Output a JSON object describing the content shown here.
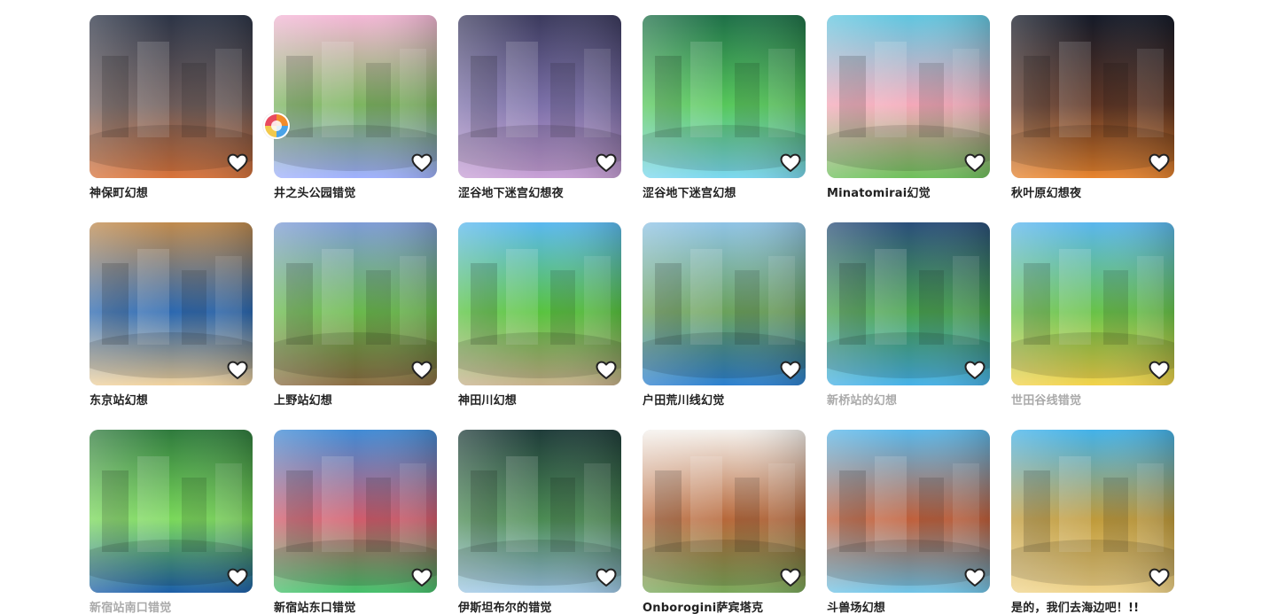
{
  "items": [
    {
      "title": "神保町幻想",
      "muted": false,
      "colors": [
        "#2c3446",
        "#6b5a58",
        "#d9733a"
      ],
      "icon": "heart-outline-icon"
    },
    {
      "title": "井之头公园错觉",
      "muted": false,
      "colors": [
        "#f4b6d6",
        "#7bb45e",
        "#9fb0ff"
      ],
      "icon": "heart-outline-icon"
    },
    {
      "title": "涩谷地下迷宫幻想夜",
      "muted": false,
      "colors": [
        "#3b3a5d",
        "#7b6fa8",
        "#c8a0d6"
      ],
      "icon": "heart-outline-icon"
    },
    {
      "title": "涩谷地下迷宫幻想",
      "muted": false,
      "colors": [
        "#1e6f48",
        "#56c75a",
        "#7ad7f0"
      ],
      "icon": "heart-outline-icon"
    },
    {
      "title": "Minatomirai幻觉",
      "muted": false,
      "colors": [
        "#5fc6e0",
        "#f4a7b8",
        "#6dc05a"
      ],
      "icon": "heart-outline-icon"
    },
    {
      "title": "秋叶原幻想夜",
      "muted": false,
      "colors": [
        "#141a28",
        "#5b3221",
        "#e8842e"
      ],
      "icon": "heart-outline-icon"
    },
    {
      "title": "东京站幻想",
      "muted": false,
      "colors": [
        "#c08a4c",
        "#2b68b0",
        "#f0d19c"
      ],
      "icon": "heart-outline-icon"
    },
    {
      "title": "上野站幻想",
      "muted": false,
      "colors": [
        "#7d9bd6",
        "#68b84a",
        "#8a6b42"
      ],
      "icon": "heart-outline-icon"
    },
    {
      "title": "神田川幻想",
      "muted": false,
      "colors": [
        "#5ab8f0",
        "#58c33e",
        "#c7b08a"
      ],
      "icon": "heart-outline-icon"
    },
    {
      "title": "户田荒川线幻觉",
      "muted": false,
      "colors": [
        "#8fc3e6",
        "#6aa15a",
        "#2b7fd0"
      ],
      "icon": "heart-outline-icon"
    },
    {
      "title": "新桥站的幻想",
      "muted": true,
      "colors": [
        "#2a4e7a",
        "#46a14d",
        "#46b1e8"
      ],
      "icon": "heart-outline-icon"
    },
    {
      "title": "世田谷线错觉",
      "muted": true,
      "colors": [
        "#5ab6ee",
        "#68c248",
        "#f3d24a"
      ],
      "icon": "heart-outline-icon"
    },
    {
      "title": "新宿站南口错觉",
      "muted": true,
      "colors": [
        "#2f7a3d",
        "#7ad85a",
        "#1c5ea8"
      ],
      "icon": "heart-outline-icon"
    },
    {
      "title": "新宿站东口错觉",
      "muted": false,
      "colors": [
        "#3f8bd6",
        "#d05a6a",
        "#43c16a"
      ],
      "icon": "heart-outline-icon"
    },
    {
      "title": "伊斯坦布尔的错觉",
      "muted": false,
      "colors": [
        "#1f3c3a",
        "#4a8a52",
        "#9ec7e6"
      ],
      "icon": "heart-outline-icon"
    },
    {
      "title": "Onborogini萨宾塔克",
      "muted": false,
      "colors": [
        "#f5f2ee",
        "#b7683a",
        "#79a85a"
      ],
      "icon": "heart-outline-icon"
    },
    {
      "title": "斗兽场幻想",
      "muted": false,
      "colors": [
        "#59b7ea",
        "#c05f3a",
        "#6fc4e8"
      ],
      "icon": "heart-outline-icon"
    },
    {
      "title": "是的，我们去海边吧！!!",
      "muted": false,
      "colors": [
        "#42b2ea",
        "#bf9a3a",
        "#f0d48a"
      ],
      "icon": "heart-outline-icon"
    }
  ],
  "badge": {
    "icon": "colorful-circle-icon"
  }
}
